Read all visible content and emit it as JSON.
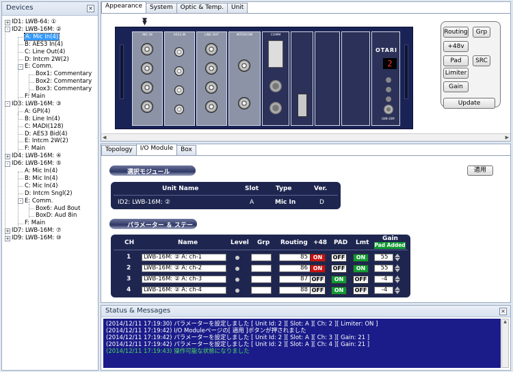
{
  "devices": {
    "title": "Devices",
    "nodes": [
      {
        "label": "ID1: LWB-64: ①",
        "exp": "+",
        "level": 0
      },
      {
        "label": "ID2: LWB-16M: ②",
        "exp": "-",
        "level": 0
      },
      {
        "label": "A: Mic In(4)",
        "level": 1,
        "selected": true
      },
      {
        "label": "B: AES3 In(4)",
        "level": 1
      },
      {
        "label": "C: Line Out(4)",
        "level": 1
      },
      {
        "label": "D: Intcm 2W(2)",
        "level": 1
      },
      {
        "label": "E: Comm.",
        "exp": "-",
        "level": 1
      },
      {
        "label": "Box1: Commentary",
        "level": 2
      },
      {
        "label": "Box2: Commentary",
        "level": 2
      },
      {
        "label": "Box3: Commentary",
        "level": 2
      },
      {
        "label": "F: Main",
        "level": 1
      },
      {
        "label": "ID3: LWB-16M: ③",
        "exp": "-",
        "level": 0
      },
      {
        "label": "A: GPI(4)",
        "level": 1
      },
      {
        "label": "B: Line In(4)",
        "level": 1
      },
      {
        "label": "C: MADI(128)",
        "level": 1
      },
      {
        "label": "D: AES3 Bid(4)",
        "level": 1
      },
      {
        "label": "E: Intcm 2W(2)",
        "level": 1
      },
      {
        "label": "F: Main",
        "level": 1
      },
      {
        "label": "ID4: LWB-16M: ④",
        "exp": "+",
        "level": 0
      },
      {
        "label": "ID6: LWB-16M: ⑤",
        "exp": "-",
        "level": 0
      },
      {
        "label": "A: Mic In(4)",
        "level": 1
      },
      {
        "label": "B: Mic In(4)",
        "level": 1
      },
      {
        "label": "C: Mic In(4)",
        "level": 1
      },
      {
        "label": "D: Intcm Sngl(2)",
        "level": 1
      },
      {
        "label": "E: Comm.",
        "exp": "-",
        "level": 1
      },
      {
        "label": "Box6: Aud 8out",
        "level": 2
      },
      {
        "label": "BoxD: Aud 8in",
        "level": 2
      },
      {
        "label": "F: Main",
        "level": 1
      },
      {
        "label": "ID7: LWB-16M: ⑦",
        "exp": "+",
        "level": 0
      },
      {
        "label": "ID9: LWB-16M: ⑩",
        "exp": "+",
        "level": 0
      }
    ]
  },
  "top_tabs": [
    "Appearance",
    "System",
    "Optic & Temp.",
    "Unit"
  ],
  "rack": {
    "cards": [
      "MIC IN",
      "AES3 IN",
      "LINE OUT",
      "INTERCOM",
      "COMM",
      "",
      "",
      "",
      ""
    ],
    "brand": "OTARI",
    "display": "2",
    "unit_label": "LWB-16M"
  },
  "controls": {
    "routing": "Routing",
    "grp": "Grp",
    "p48v": "+48v",
    "pad": "Pad",
    "src": "SRC",
    "limiter": "Limiter",
    "gain": "Gain",
    "update": "Update"
  },
  "mod_tabs": [
    "Topology",
    "I/O Module",
    "Box"
  ],
  "apply": "適用",
  "module_section": "選択モジュール",
  "module_headers": {
    "unit": "Unit Name",
    "slot": "Slot",
    "type": "Type",
    "ver": "Ver."
  },
  "module_row": {
    "unit": "ID2: LWB-16M: ②",
    "slot": "A",
    "type": "Mic In",
    "ver": "D"
  },
  "param_section": "パラメーター ＆ ステータス",
  "param_headers": {
    "ch": "CH",
    "name": "Name",
    "level": "Level",
    "grp": "Grp",
    "routing": "Routing",
    "p48": "+48",
    "pad": "PAD",
    "lmt": "Lmt",
    "gain": "Gain",
    "pad_added": "Pad Added"
  },
  "channels": [
    {
      "ch": "1",
      "name": "LWB-16M: ② A: ch-1",
      "routing": "85",
      "p48": "ON",
      "pad": "OFF",
      "lmt": "ON",
      "gain": "55"
    },
    {
      "ch": "2",
      "name": "LWB-16M: ② A: ch-2",
      "routing": "86",
      "p48": "ON",
      "pad": "OFF",
      "lmt": "ON",
      "gain": "55"
    },
    {
      "ch": "3",
      "name": "LWB-16M: ② A: ch-3",
      "routing": "87",
      "p48": "OFF",
      "pad": "ON",
      "lmt": "OFF",
      "gain": "-4"
    },
    {
      "ch": "4",
      "name": "LWB-16M: ② A: ch-4",
      "routing": "88",
      "p48": "OFF",
      "pad": "ON",
      "lmt": "OFF",
      "gain": "-4"
    }
  ],
  "colors": {
    "on_red": "#cc1111",
    "on_green": "#119a33",
    "panel": "#1e2650",
    "log_bg": "#1b1c8a"
  },
  "status": {
    "title": "Status & Messages",
    "lines": [
      {
        "text": "(2014/12/11 17:19:30) パラメーターを設定しました [ Unit Id: 2 ][ Slot: A ][ Ch: 2 ][ Limiter: ON ]",
        "green": false
      },
      {
        "text": "(2014/12/11 17:19:42) I/O Moduleページの[ 適用 ]ボタンが押されました",
        "green": false
      },
      {
        "text": "(2014/12/11 17:19:42) パラメーターを設定しました [ Unit Id: 2 ][ Slot: A ][ Ch: 3 ][ Gain: 21 ]",
        "green": false
      },
      {
        "text": "(2014/12/11 17:19:42) パラメーターを設定しました [ Unit Id: 2 ][ Slot: A ][ Ch: 4 ][ Gain: 21 ]",
        "green": false
      },
      {
        "text": "(2014/12/11 17:19:43) 操作可能な状態になりました",
        "green": true
      }
    ]
  }
}
